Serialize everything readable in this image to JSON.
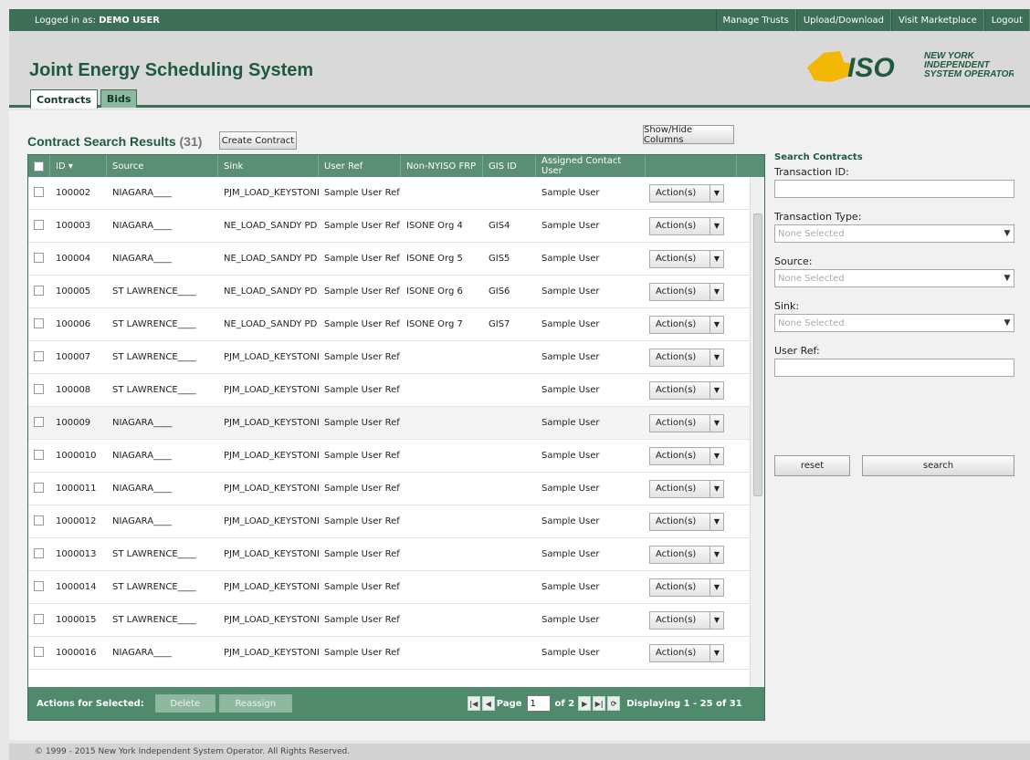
{
  "topbar": {
    "login_prefix": "Logged in as:",
    "user": "DEMO USER",
    "links": [
      "Manage Trusts",
      "Upload/Download",
      "Visit Marketplace",
      "Logout"
    ]
  },
  "header": {
    "title": "Joint Energy Scheduling System",
    "logo_iso": "ISO",
    "logo_lines": [
      "NEW YORK",
      "INDEPENDENT",
      "SYSTEM OPERATOR"
    ],
    "tabs": [
      "Contracts",
      "Bids"
    ]
  },
  "results": {
    "title": "Contract Search Results",
    "count": "(31)",
    "create_button": "Create Contract",
    "showhide_button": "Show/Hide Columns"
  },
  "grid": {
    "columns": [
      "ID ▾",
      "Source",
      "Sink",
      "User Ref",
      "Non-NYISO FRP",
      "GIS ID",
      "Assigned Contact User",
      ""
    ],
    "action_label": "Action(s)",
    "rows": [
      {
        "id": "100002",
        "source": "NIAGARA____",
        "sink": "PJM_LOAD_KEYSTONE",
        "user_ref": "Sample User Ref",
        "frp": "",
        "gis": "",
        "contact": "Sample User"
      },
      {
        "id": "100003",
        "source": "NIAGARA____",
        "sink": "NE_LOAD_SANDY PD",
        "user_ref": "Sample User Ref",
        "frp": "ISONE Org 4",
        "gis": "GIS4",
        "contact": "Sample User"
      },
      {
        "id": "100004",
        "source": "NIAGARA____",
        "sink": "NE_LOAD_SANDY PD",
        "user_ref": "Sample User Ref",
        "frp": "ISONE Org 5",
        "gis": "GIS5",
        "contact": "Sample User"
      },
      {
        "id": "100005",
        "source": "ST LAWRENCE____",
        "sink": "NE_LOAD_SANDY PD",
        "user_ref": "Sample User Ref",
        "frp": "ISONE Org 6",
        "gis": "GIS6",
        "contact": "Sample User"
      },
      {
        "id": "100006",
        "source": "ST LAWRENCE____",
        "sink": "NE_LOAD_SANDY PD",
        "user_ref": "Sample User Ref",
        "frp": "ISONE Org 7",
        "gis": "GIS7",
        "contact": "Sample User"
      },
      {
        "id": "100007",
        "source": "ST LAWRENCE____",
        "sink": "PJM_LOAD_KEYSTONE",
        "user_ref": "Sample User Ref",
        "frp": "",
        "gis": "",
        "contact": "Sample User"
      },
      {
        "id": "100008",
        "source": "ST LAWRENCE____",
        "sink": "PJM_LOAD_KEYSTONE",
        "user_ref": "Sample User Ref",
        "frp": "",
        "gis": "",
        "contact": "Sample User"
      },
      {
        "id": "100009",
        "source": "NIAGARA____",
        "sink": "PJM_LOAD_KEYSTONE",
        "user_ref": "Sample User Ref",
        "frp": "",
        "gis": "",
        "contact": "Sample User"
      },
      {
        "id": "1000010",
        "source": "NIAGARA____",
        "sink": "PJM_LOAD_KEYSTONE",
        "user_ref": "Sample User Ref",
        "frp": "",
        "gis": "",
        "contact": "Sample User"
      },
      {
        "id": "1000011",
        "source": "NIAGARA____",
        "sink": "PJM_LOAD_KEYSTONE",
        "user_ref": "Sample User Ref",
        "frp": "",
        "gis": "",
        "contact": "Sample User"
      },
      {
        "id": "1000012",
        "source": "NIAGARA____",
        "sink": "PJM_LOAD_KEYSTONE",
        "user_ref": "Sample User Ref",
        "frp": "",
        "gis": "",
        "contact": "Sample User"
      },
      {
        "id": "1000013",
        "source": "ST LAWRENCE____",
        "sink": "PJM_LOAD_KEYSTONE",
        "user_ref": "Sample User Ref",
        "frp": "",
        "gis": "",
        "contact": "Sample User"
      },
      {
        "id": "1000014",
        "source": "ST LAWRENCE____",
        "sink": "PJM_LOAD_KEYSTONE",
        "user_ref": "Sample User Ref",
        "frp": "",
        "gis": "",
        "contact": "Sample User"
      },
      {
        "id": "1000015",
        "source": "ST LAWRENCE____",
        "sink": "PJM_LOAD_KEYSTONE",
        "user_ref": "Sample User Ref",
        "frp": "",
        "gis": "",
        "contact": "Sample User"
      },
      {
        "id": "1000016",
        "source": "NIAGARA____",
        "sink": "PJM_LOAD_KEYSTONE",
        "user_ref": "Sample User Ref",
        "frp": "",
        "gis": "",
        "contact": "Sample User"
      }
    ]
  },
  "footer_bar": {
    "actions_label": "Actions for Selected:",
    "delete": "Delete",
    "reassign": "Reassign",
    "page_label": "Page",
    "page_value": "1",
    "of_label": "of 2",
    "displaying": "Displaying 1 - 25 of 31"
  },
  "search": {
    "title": "Search Contracts",
    "transaction_id_label": "Transaction ID:",
    "transaction_type_label": "Transaction Type:",
    "source_label": "Source:",
    "sink_label": "Sink:",
    "user_ref_label": "User Ref:",
    "none_selected": "None Selected",
    "reset": "reset",
    "search": "search"
  },
  "footer": {
    "copyright": "© 1999 - 2015 New York Independent System Operator. All Rights Reserved."
  },
  "colors": {
    "brand_green": "#3c6e58",
    "title_green": "#1e5a3e",
    "logo_yellow": "#f2b705"
  }
}
